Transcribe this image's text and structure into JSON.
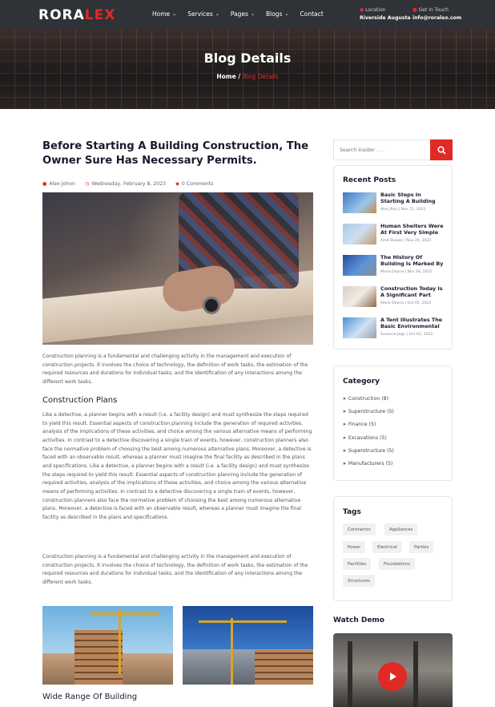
{
  "header": {
    "logo_main": "RORA",
    "logo_accent": "LEX",
    "nav": [
      {
        "label": "Home",
        "has_dropdown": true
      },
      {
        "label": "Services",
        "has_dropdown": true
      },
      {
        "label": "Pages",
        "has_dropdown": true
      },
      {
        "label": "Blogs",
        "has_dropdown": true
      },
      {
        "label": "Contact",
        "has_dropdown": false
      }
    ],
    "location_label": "Location",
    "location_value": "Riverside Augusta",
    "contact_label": "Get In Touch",
    "contact_value": "info@roralex.com"
  },
  "hero": {
    "title": "Blog Details",
    "crumb_home": "Home",
    "crumb_sep": "/",
    "crumb_current": "Blog Details"
  },
  "post": {
    "title": "Before Starting A Building Construction, The Owner Sure Has Necessary Permits.",
    "author": "Alex Johon",
    "date": "Wednesday, February 8, 2023",
    "comments": "0 Comments",
    "para1": "Construction planning is a fundamental and challenging activity in the management and execution of construction projects. It involves the choice of technology, the definition of work tasks, the estimation of the required resources and durations for individual tasks, and the identification of any interactions among the different work tasks.",
    "subheading": "Construction Plans",
    "para2": "Like a detective, a planner begins with a result (i.e. a facility design) and must synthesize the steps required to yield this result. Essential aspects of construction planning include the generation of required activities, analysis of the implications of these activities, and choice among the various alternative means of performing activities. In contrast to a detective discovering a single train of events, however, construction planners also face the normative problem of choosing the best among numerous alternative plans. Moreover, a detective is faced with an observable result, whereas a planner must imagine the final facility as described in the plans and specifications. Like a detective, a planner begins with a result (i.e. a facility design) and must synthesize the steps required to yield this result. Essential aspects of construction planning include the generation of required activities, analysis of the implications of these activities, and choice among the various alternative means of performing activities. In contrast to a detective discovering a single train of events, however, construction planners also face the normative problem of choosing the best among numerous alternative plans. Moreover, a detective is faced with an observable result, whereas a planner must imagine the final facility as described in the plans and specifications.",
    "para3": "Construction planning is a fundamental and challenging activity in the management and execution of construction projects. It involves the choice of technology, the definition of work tasks, the estimation of the required resources and durations for individual tasks, and the identification of any interactions among the different work tasks.",
    "subheading2": "Wide Range Of Building"
  },
  "sidebar": {
    "search_placeholder": "Search Insider . . .",
    "recent_title": "Recent Posts",
    "recent": [
      {
        "title": "Basic Steps In Starting A Building",
        "meta": "Alex Jhon | Nov 21, 2022"
      },
      {
        "title": "Human Shelters Were At First Very Simple",
        "meta": "Amit Biswas | Nov 26, 2022"
      },
      {
        "title": "The History Of Building Is Marked By",
        "meta": "Mario Doyna | Nov 28, 2022"
      },
      {
        "title": "Construction Today Is A Significant Part",
        "meta": "Mario Doyna | Oct 05, 2022"
      },
      {
        "title": "A Tent Illustrates The Basic Environmental",
        "meta": "Susanne Jage | Oct 01, 2022"
      }
    ],
    "category_title": "Category",
    "categories": [
      "Construction (8)",
      "Superstructure (5)",
      "Finance (5)",
      "Excavations (5)",
      "Superstructure (5)",
      "Manufacturers (5)"
    ],
    "tags_title": "Tags",
    "tags": [
      "Contractor",
      "Appliances",
      "Power",
      "Electrical",
      "Parties",
      "Facilities",
      "Foundations",
      "Structures"
    ],
    "watch_title": "Watch Demo"
  },
  "colors": {
    "accent": "#e12926",
    "dark": "#2f3236",
    "heading": "#1a1a2e"
  }
}
